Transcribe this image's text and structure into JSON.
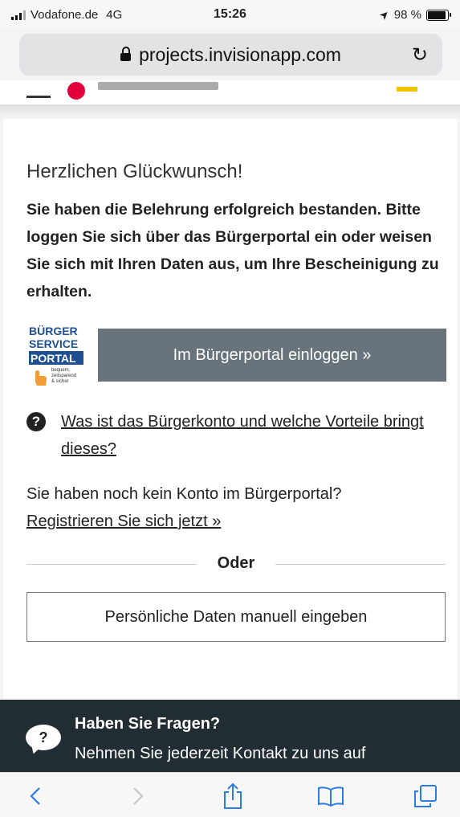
{
  "status_bar": {
    "carrier": "Vodafone.de",
    "network": "4G",
    "time": "15:26",
    "battery": "98 %",
    "battery_level": 0.98
  },
  "browser": {
    "url": "projects.invisionapp.com"
  },
  "content": {
    "heading": "Herzlichen Glückwunsch!",
    "intro": "Sie haben die Belehrung erfolgreich bestanden. Bitte loggen Sie sich über das Bürgerportal ein oder weisen Sie sich mit Ihren Daten aus, um Ihre Bescheinigung zu erhalten.",
    "logo": {
      "line1": "BÜRGER",
      "line2": "SERVICE",
      "line3": "PORTAL",
      "tagline1": "bequem,",
      "tagline2": "zeitsparend",
      "tagline3": "& sicher"
    },
    "login_button": "Im Bürgerportal einloggen »",
    "faq_link": "Was ist das Bürgerkonto und welche Vorteile bringt dieses?",
    "no_account_text": "Sie haben noch kein Konto im Bürgerportal?",
    "register_link": "Registrieren Sie sich jetzt »",
    "divider_label": "Oder",
    "manual_button": "Persönliche Daten manuell eingeben"
  },
  "footer": {
    "title": "Haben Sie Fragen?",
    "text": "Nehmen Sie jederzeit Kontakt zu uns auf",
    "icon_glyph": "?"
  },
  "colors": {
    "primary_button": "#68737c",
    "footer_bg": "#222c33",
    "toolbar_accent": "#2d7be5",
    "logo_blue": "#1d4f91"
  }
}
